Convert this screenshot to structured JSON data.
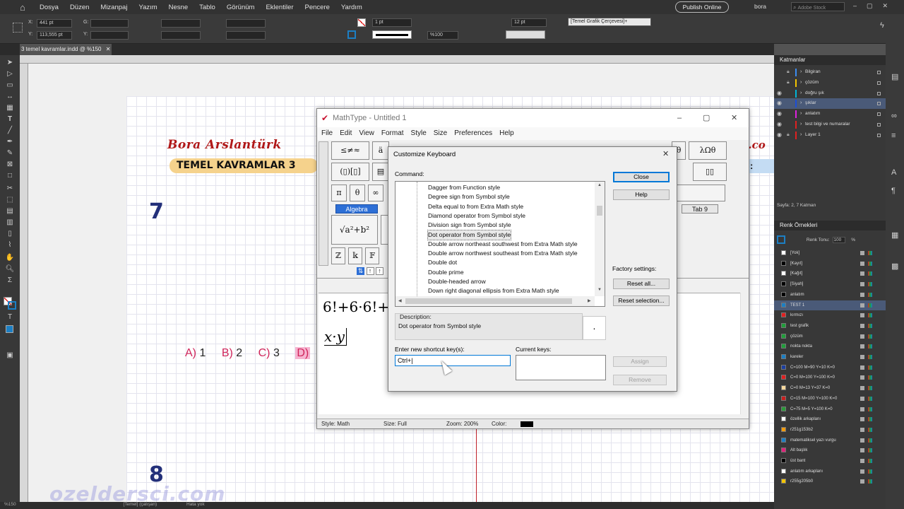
{
  "menu": {
    "items": [
      "Dosya",
      "Düzen",
      "Mizanpaj",
      "Yazım",
      "Nesne",
      "Tablo",
      "Görünüm",
      "Eklentiler",
      "Pencere",
      "Yardım"
    ],
    "publish": "Publish Online",
    "user": "bora",
    "search_placeholder": "Adobe Stock"
  },
  "control": {
    "x_label": "X:",
    "x": "441 pt",
    "y_label": "Y:",
    "y": "113,555 pt",
    "w_label": "G:",
    "h_label": "Y:",
    "stroke": "1 pt",
    "scale": "%100",
    "size": "12 pt",
    "frame_style": "[Temel Grafik Çerçevesi]+"
  },
  "doc_tab": "3 temel kavramlar.indd @ %150",
  "page": {
    "author": "Bora Arslantürk",
    "banner": "TEMEL KAVRAMLAR 3",
    "right_text": "il.co",
    "right_colon": ":",
    "q7": "7",
    "q8": "8",
    "options": [
      {
        "letter": "A)",
        "val": "1"
      },
      {
        "letter": "B)",
        "val": "2"
      },
      {
        "letter": "C)",
        "val": "3"
      },
      {
        "letter": "D)",
        "val": ""
      }
    ],
    "watermark": "ozeldersci.com"
  },
  "status": {
    "zoom": "%150",
    "style": "[Temel] (çalışan)",
    "errors": "Hata yok"
  },
  "layers": {
    "title": "Katmanlar",
    "items": [
      "Bilgiran",
      "çözüm",
      "doğru şık",
      "şıklar",
      "anlatım",
      "test bilgi ve numaralar",
      "Layer 1"
    ],
    "footer": "Sayfa: 2, 7 Katman"
  },
  "swatches": {
    "title": "Renk Örnekleri",
    "tint_label": "Renk Tonu:",
    "tint": "100",
    "tint_unit": "%",
    "items": [
      "[Yok]",
      "[Kayıt]",
      "[Kağıt]",
      "[Siyah]",
      "anlatım",
      "TEST 1",
      "kırmızı",
      "test grafik",
      "çözüm",
      "nokta nokta",
      "kareler",
      "C=100 M=90 Y=10 K=0",
      "C=0 M=100 Y=100 K=0",
      "C=0 M=13 Y=37 K=0",
      "C=15 M=100 Y=100 K=0",
      "C=75 M=5 Y=100 K=0",
      "özellik arkaplanı",
      "r251g153b2",
      "matematiksel yazı vurgu",
      "Alt başlık",
      "üst bant",
      "anlatım arkaplanı",
      "r255g205b0"
    ],
    "colors": [
      "#ffffff",
      "#000000",
      "#ffffff",
      "#000000",
      "#000000",
      "#1c7fc4",
      "#e02020",
      "#1f9e3a",
      "#1f9e3a",
      "#1f9e3a",
      "#1c7fc4",
      "#1c3fa0",
      "#e02020",
      "#f7d89c",
      "#c81e1e",
      "#2a9a3a",
      "#ffffff",
      "#f29b0c",
      "#1c7fc4",
      "#e0207a",
      "#000000",
      "#ffffff",
      "#f2c400"
    ]
  },
  "mathtype": {
    "title": "MathType - Untitled 1",
    "menu": [
      "File",
      "Edit",
      "View",
      "Format",
      "Style",
      "Size",
      "Preferences",
      "Help"
    ],
    "row1": [
      "≤≠≈",
      "ä",
      "θ",
      "λΩθ"
    ],
    "row2": [
      "(▯)[▯]",
      "▤",
      "▯▯"
    ],
    "row3": [
      "π",
      "θ",
      "∞"
    ],
    "tabs": [
      "Algebra",
      "Tab 9"
    ],
    "sqrt": "√a²+b²",
    "row5": [
      "ℤ",
      "𝕜",
      "𝔽"
    ],
    "expr1": "6!+6·6!+",
    "expr2": "x·y",
    "status": {
      "style": "Style: Math",
      "size": "Size: Full",
      "zoom": "Zoom: 200%",
      "color": "Color:"
    }
  },
  "dialog": {
    "title": "Customize Keyboard",
    "command_label": "Command:",
    "commands": [
      "Dagger from Function style",
      "Degree sign from Symbol style",
      "Delta equal to from Extra Math style",
      "Diamond operator from Symbol style",
      "Division sign from Symbol style",
      "Dot operator from Symbol style",
      "Double arrow northeast southwest from Extra Math style",
      "Double arrow northwest southeast from Extra Math style",
      "Double dot",
      "Double prime",
      "Double-headed arrow",
      "Down right diagonal ellipsis from Extra Math style"
    ],
    "close": "Close",
    "help": "Help",
    "factory_label": "Factory settings:",
    "reset_all": "Reset all...",
    "reset_selection": "Reset selection...",
    "desc_label": "Description:",
    "description": "Dot operator from Symbol style",
    "preview": "·",
    "shortcut_label": "Enter new shortcut key(s):",
    "shortcut_value": "Ctrl+|",
    "current_label": "Current keys:",
    "assign": "Assign",
    "remove": "Remove"
  }
}
